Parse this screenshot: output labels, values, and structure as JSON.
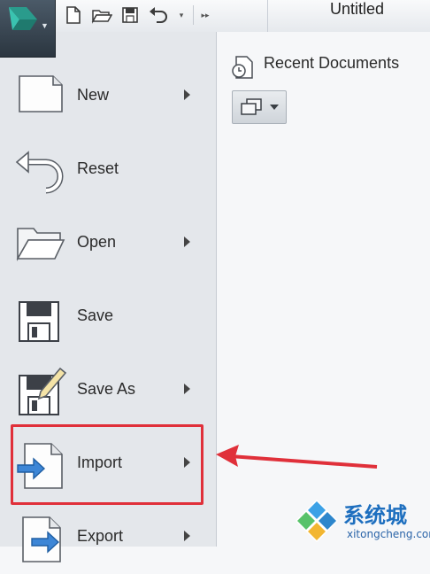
{
  "window": {
    "title": "Untitled"
  },
  "quick_access": {
    "icons": [
      "new-file-icon",
      "open-folder-icon",
      "save-icon",
      "undo-icon",
      "dropdown-caret-icon",
      "overflow-icon"
    ]
  },
  "app_menu": {
    "items": [
      {
        "label": "New",
        "icon": "new-document-icon",
        "has_submenu": true
      },
      {
        "label": "Reset",
        "icon": "reset-icon",
        "has_submenu": false
      },
      {
        "label": "Open",
        "icon": "open-folder-icon",
        "has_submenu": true
      },
      {
        "label": "Save",
        "icon": "floppy-disk-icon",
        "has_submenu": false
      },
      {
        "label": "Save As",
        "icon": "save-as-icon",
        "has_submenu": true
      },
      {
        "label": "Import",
        "icon": "import-icon",
        "has_submenu": true
      },
      {
        "label": "Export",
        "icon": "export-icon",
        "has_submenu": true
      }
    ],
    "highlighted_item": "Import"
  },
  "recent_documents": {
    "label": "Recent Documents",
    "icon": "clock-document-icon"
  },
  "annotation": {
    "color": "#e0303a"
  },
  "watermark": {
    "text": "系统城",
    "url": "xitongcheng.com"
  }
}
